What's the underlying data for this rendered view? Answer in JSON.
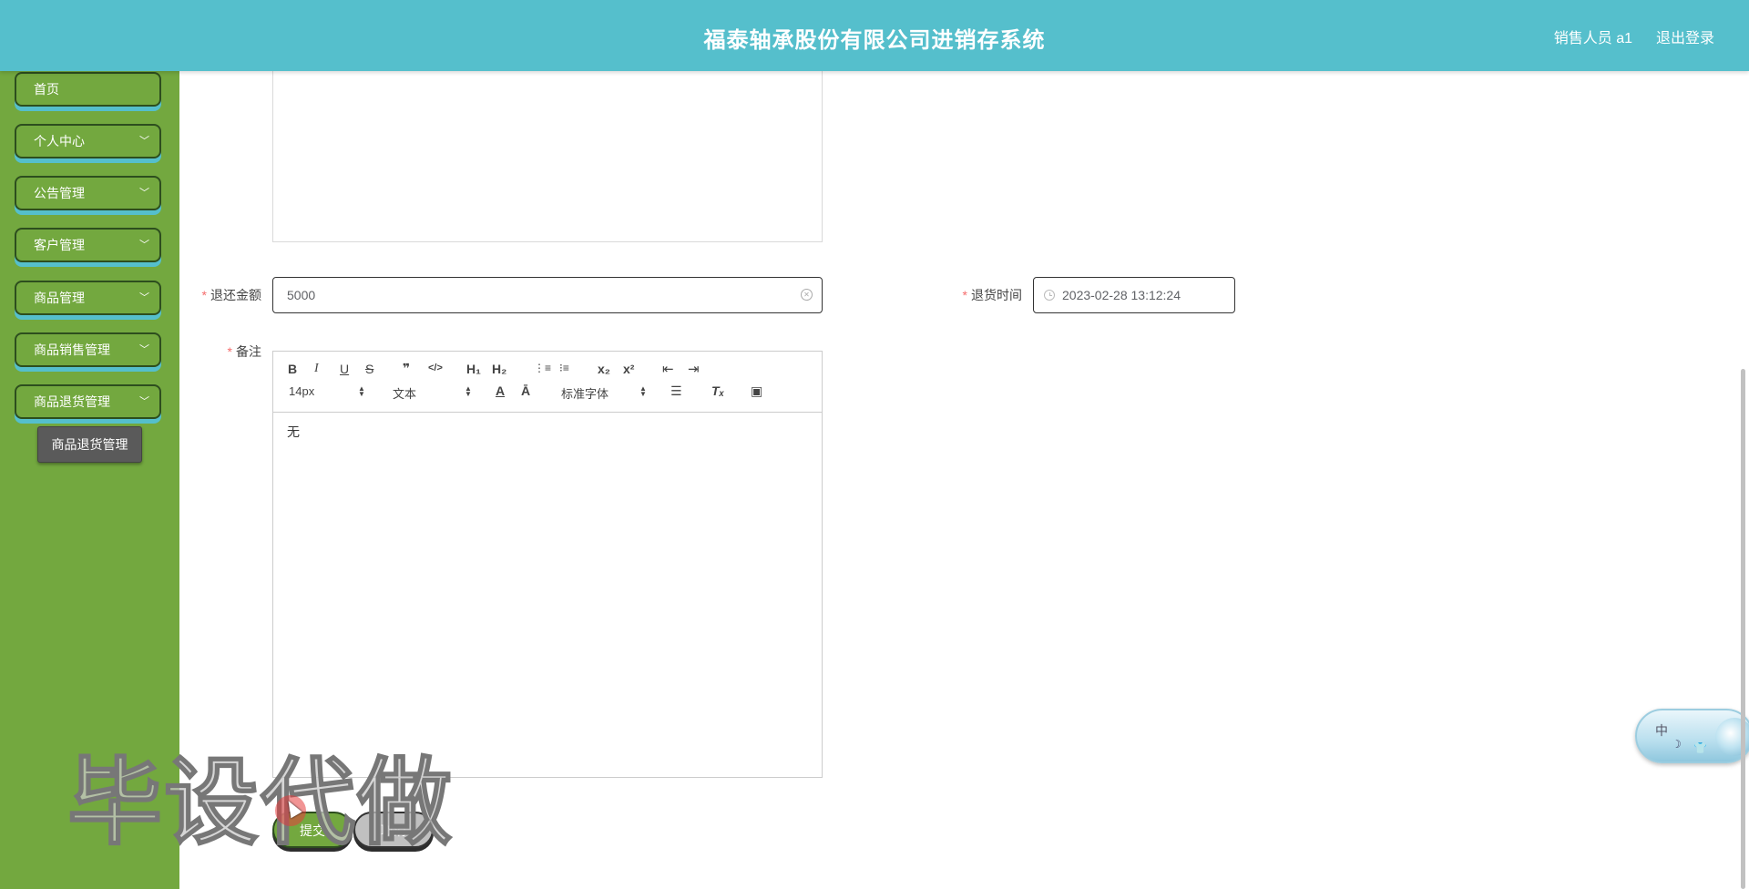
{
  "header": {
    "title": "福泰轴承股份有限公司进销存系统",
    "user": "销售人员 a1",
    "logout": "退出登录"
  },
  "sidebar": {
    "items": [
      {
        "label": "首页",
        "has_arrow": false
      },
      {
        "label": "个人中心",
        "has_arrow": true
      },
      {
        "label": "公告管理",
        "has_arrow": true
      },
      {
        "label": "客户管理",
        "has_arrow": true
      },
      {
        "label": "商品管理",
        "has_arrow": true
      },
      {
        "label": "商品销售管理",
        "has_arrow": true
      },
      {
        "label": "商品退货管理",
        "has_arrow": true
      }
    ],
    "submenu": {
      "label": "商品退货管理"
    }
  },
  "form": {
    "refund_amount": {
      "label": "退还金额",
      "value": "5000"
    },
    "return_time": {
      "label": "退货时间",
      "value": "2023-02-28 13:12:24"
    },
    "remark": {
      "label": "备注"
    }
  },
  "editor": {
    "toolbar": {
      "bold": "B",
      "italic": "I",
      "underline": "U",
      "strike": "S",
      "quote": "❞",
      "code": "</>",
      "h1": "H₁",
      "h2": "H₂",
      "ol": "⋮≡",
      "ul": "⁝≡",
      "sub": "x₂",
      "sup": "x²",
      "outdent": "⇤",
      "indent": "⇥",
      "size": "14px",
      "header": "文本",
      "color": "A",
      "background": "Ā",
      "font": "标准字体",
      "align": "☰",
      "clean": "Tₓ",
      "image": "▣"
    },
    "content": "无"
  },
  "buttons": {
    "submit": "提交",
    "cancel": "取消"
  },
  "watermark": "毕设代做",
  "ime": {
    "label": "中",
    "moon": "☽",
    "shirt": "👕"
  },
  "colors": {
    "header_bg": "#55bfcc",
    "sidebar_bg": "#73a83f",
    "menu_border": "#2d4e1e",
    "required": "#f56c6c"
  }
}
